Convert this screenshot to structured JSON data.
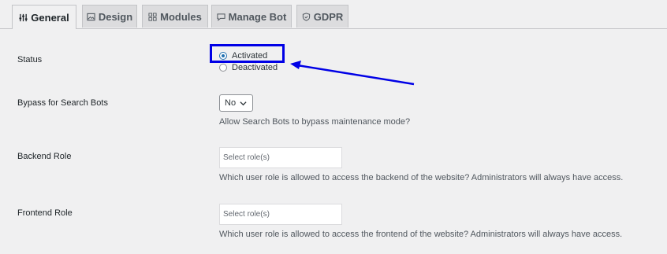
{
  "tabs": [
    {
      "label": "General",
      "icon": "sliders-icon"
    },
    {
      "label": "Design",
      "icon": "image-icon"
    },
    {
      "label": "Modules",
      "icon": "grid-icon"
    },
    {
      "label": "Manage Bot",
      "icon": "chat-icon"
    },
    {
      "label": "GDPR",
      "icon": "shield-icon"
    }
  ],
  "status": {
    "label": "Status",
    "options": [
      "Activated",
      "Deactivated"
    ],
    "selected": "Activated"
  },
  "bypass": {
    "label": "Bypass for Search Bots",
    "value": "No",
    "description": "Allow Search Bots to bypass maintenance mode?"
  },
  "backend_role": {
    "label": "Backend Role",
    "placeholder": "Select role(s)",
    "description": "Which user role is allowed to access the backend of the website? Administrators will always have access."
  },
  "frontend_role": {
    "label": "Frontend Role",
    "placeholder": "Select role(s)",
    "description": "Which user role is allowed to access the frontend of the website? Administrators will always have access."
  },
  "colors": {
    "annotation": "#0000e6",
    "accent": "#2271b1"
  }
}
